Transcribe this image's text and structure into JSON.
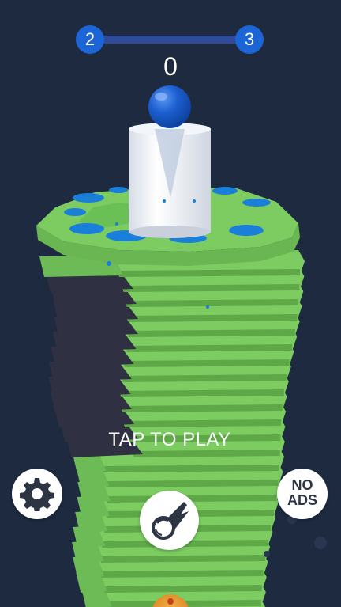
{
  "level_progress": {
    "current_level": "2",
    "next_level": "3",
    "progress": 0
  },
  "score": "0",
  "prompt": "TAP TO PLAY",
  "buttons": {
    "settings_icon": "gear-icon",
    "no_ads_line1": "NO",
    "no_ads_line2": "ADS",
    "ball_skin_icon": "comet-ball-icon"
  },
  "colors": {
    "background": "#1e2a40",
    "platform_green": "#7ccc62",
    "platform_dark": "#2f3142",
    "ball_blue": "#1c5fd0",
    "splat_blue": "#1a7fd8",
    "level_node": "#1c65d6",
    "level_track": "#2f4a9a"
  }
}
